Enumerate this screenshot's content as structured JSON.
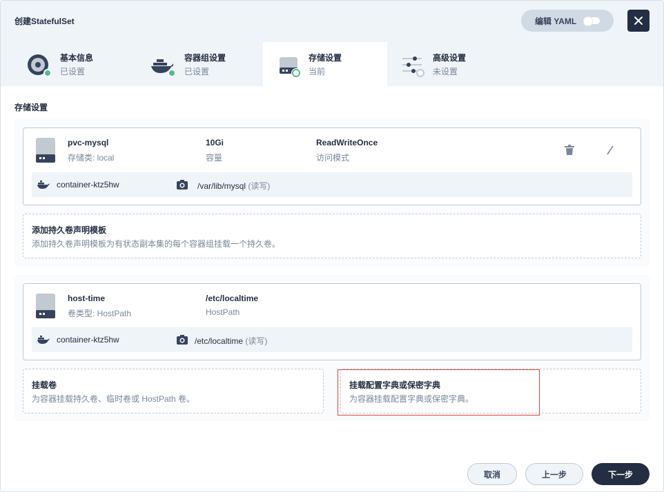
{
  "header": {
    "title": "创建StatefulSet",
    "yaml_label": "编辑 YAML"
  },
  "steps": [
    {
      "name": "基本信息",
      "status": "已设置",
      "icon": "disc-icon",
      "state": "done"
    },
    {
      "name": "容器组设置",
      "status": "已设置",
      "icon": "docker-icon",
      "state": "done"
    },
    {
      "name": "存储设置",
      "status": "当前",
      "icon": "storage-icon",
      "state": "current"
    },
    {
      "name": "高级设置",
      "status": "未设置",
      "icon": "sliders-icon",
      "state": "pending"
    }
  ],
  "section_title": "存储设置",
  "pvc_card": {
    "name": "pvc-mysql",
    "sub": "存储类: local",
    "capacity": "10Gi",
    "capacity_label": "容量",
    "access_mode": "ReadWriteOnce",
    "access_mode_label": "访问模式",
    "container": "container-ktz5hw",
    "mount_path": "/var/lib/mysql",
    "mount_mode": "(读写)"
  },
  "add_pvc": {
    "title": "添加持久卷声明模板",
    "desc": "添加持久卷声明模板为有状态副本集的每个容器组挂载一个持久卷。"
  },
  "volume_card": {
    "name": "host-time",
    "sub": "卷类型: HostPath",
    "path": "/etc/localtime",
    "path_label": "HostPath",
    "container": "container-ktz5hw",
    "mount_path": "/etc/localtime",
    "mount_mode": "(读写)"
  },
  "mount_volume": {
    "title": "挂载卷",
    "desc": "为容器挂载持久卷、临时卷或 HostPath 卷。"
  },
  "mount_config": {
    "title": "挂载配置字典或保密字典",
    "desc": "为容器挂载配置字典或保密字典。"
  },
  "footer": {
    "cancel": "取消",
    "prev": "上一步",
    "next": "下一步"
  },
  "colors": {
    "primary_dark": "#242e42",
    "success": "#55bc8a",
    "highlight": "#e0433f",
    "muted": "#79879c"
  }
}
